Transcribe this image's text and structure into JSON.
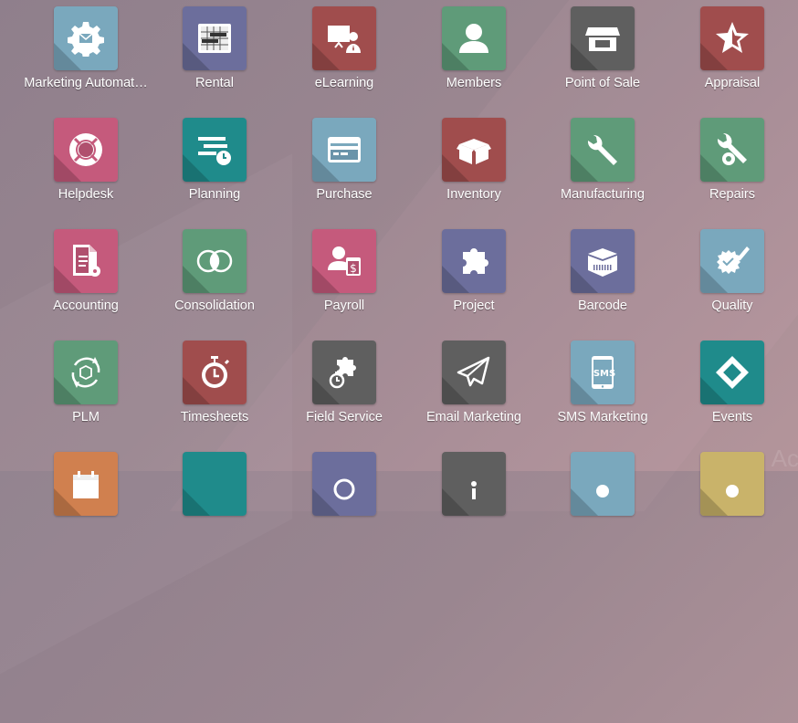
{
  "apps": [
    {
      "label": "Marketing Automat…",
      "icon": "gear-envelope-icon",
      "color": "#7aa8bd"
    },
    {
      "label": "Rental",
      "icon": "calendar-grid-icon",
      "color": "#6c6e9c"
    },
    {
      "label": "eLearning",
      "icon": "presenter-board-icon",
      "color": "#a04d4d"
    },
    {
      "label": "Members",
      "icon": "user-icon",
      "color": "#5f9b79"
    },
    {
      "label": "Point of Sale",
      "icon": "shop-icon",
      "color": "#5f5f5f"
    },
    {
      "label": "Appraisal",
      "icon": "star-icon",
      "color": "#a04d4d"
    },
    {
      "label": "Helpdesk",
      "icon": "life-ring-icon",
      "color": "#c55a7c"
    },
    {
      "label": "Planning",
      "icon": "planning-clock-icon",
      "color": "#1f8b8b"
    },
    {
      "label": "Purchase",
      "icon": "credit-card-icon",
      "color": "#7aa8bd"
    },
    {
      "label": "Inventory",
      "icon": "open-box-icon",
      "color": "#a04d4d"
    },
    {
      "label": "Manufacturing",
      "icon": "wrench-icon",
      "color": "#5f9b79"
    },
    {
      "label": "Repairs",
      "icon": "wrench-gear-icon",
      "color": "#5f9b79"
    },
    {
      "label": "Accounting",
      "icon": "document-gear-icon",
      "color": "#c55a7c"
    },
    {
      "label": "Consolidation",
      "icon": "overlapping-circles-icon",
      "color": "#5f9b79"
    },
    {
      "label": "Payroll",
      "icon": "user-payslip-icon",
      "color": "#c55a7c"
    },
    {
      "label": "Project",
      "icon": "puzzle-icon",
      "color": "#6c6e9c"
    },
    {
      "label": "Barcode",
      "icon": "barcode-box-icon",
      "color": "#6c6e9c"
    },
    {
      "label": "Quality",
      "icon": "badge-check-pencil-icon",
      "color": "#7aa8bd"
    },
    {
      "label": "PLM",
      "icon": "cycle-box-icon",
      "color": "#5f9b79"
    },
    {
      "label": "Timesheets",
      "icon": "stopwatch-icon",
      "color": "#a04d4d"
    },
    {
      "label": "Field Service",
      "icon": "puzzle-stopwatch-icon",
      "color": "#5f5f5f"
    },
    {
      "label": "Email Marketing",
      "icon": "paper-plane-icon",
      "color": "#5f5f5f"
    },
    {
      "label": "SMS Marketing",
      "icon": "sms-tablet-icon",
      "color": "#7aa8bd"
    },
    {
      "label": "Events",
      "icon": "ticket-icon",
      "color": "#1f8b8b"
    },
    {
      "label": "",
      "icon": "calendar-icon",
      "color": "#d0804f"
    },
    {
      "label": "",
      "icon": "teal-app-icon",
      "color": "#1f8b8b"
    },
    {
      "label": "",
      "icon": "circle-app-icon",
      "color": "#6c6e9c"
    },
    {
      "label": "",
      "icon": "info-app-icon",
      "color": "#5f5f5f"
    },
    {
      "label": "",
      "icon": "user-app-icon",
      "color": "#7aa8bd"
    },
    {
      "label": "",
      "icon": "user-app-icon",
      "color": "#c9b36a"
    }
  ],
  "watermark": "Acti"
}
